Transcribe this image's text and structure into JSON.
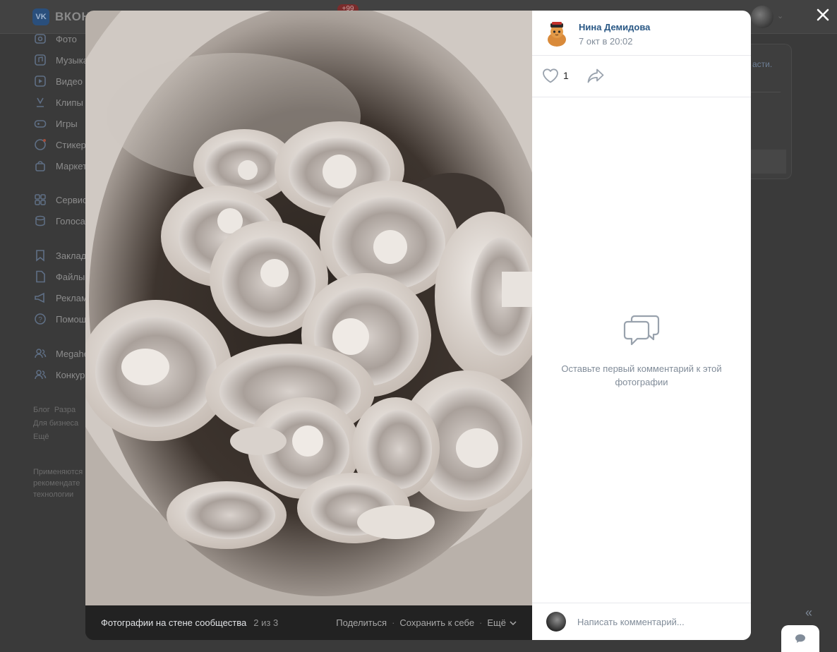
{
  "background": {
    "brand": "ВКОН",
    "notifications_badge": "+99",
    "sidebar": [
      {
        "label": "Фото",
        "icon": "photo-icon"
      },
      {
        "label": "Музыка",
        "icon": "music-icon"
      },
      {
        "label": "Видео",
        "icon": "video-icon"
      },
      {
        "label": "Клипы",
        "icon": "clips-icon"
      },
      {
        "label": "Игры",
        "icon": "games-icon"
      },
      {
        "label": "Стикер",
        "icon": "stickers-icon"
      },
      {
        "label": "Маркет",
        "icon": "market-icon"
      },
      {
        "label": "Сервис",
        "icon": "services-icon"
      },
      {
        "label": "Голоса",
        "icon": "votes-icon"
      },
      {
        "label": "Заклад",
        "icon": "bookmarks-icon"
      },
      {
        "label": "Файлы",
        "icon": "files-icon"
      },
      {
        "label": "Реклам",
        "icon": "ads-icon"
      },
      {
        "label": "Помощ",
        "icon": "help-icon"
      },
      {
        "label": "Megahe",
        "icon": "group-icon"
      },
      {
        "label": "Конкур",
        "icon": "group-icon"
      }
    ],
    "footer_links": [
      "Блог",
      "Разра",
      "Для бизнеса",
      "Ещё"
    ],
    "footer_note": [
      "Применяются",
      "рекомендате",
      "технологии"
    ],
    "right_card_text": "асти."
  },
  "viewer": {
    "album_title": "Фотографии на стене сообщества",
    "counter": "2 из 3",
    "share_label": "Поделиться",
    "save_label": "Сохранить к себе",
    "more_label": "Ещё"
  },
  "post": {
    "author_name": "Нина Демидова",
    "date": "7 окт в 20:02",
    "likes": "1",
    "empty_comments_text": "Оставьте первый комментарий к этой фотографии",
    "comment_placeholder": "Написать комментарий..."
  },
  "colors": {
    "author_link": "#2a5885",
    "secondary_text": "#818c99",
    "overlay": "#3a3a3a",
    "viewer_footer": "#222222"
  }
}
